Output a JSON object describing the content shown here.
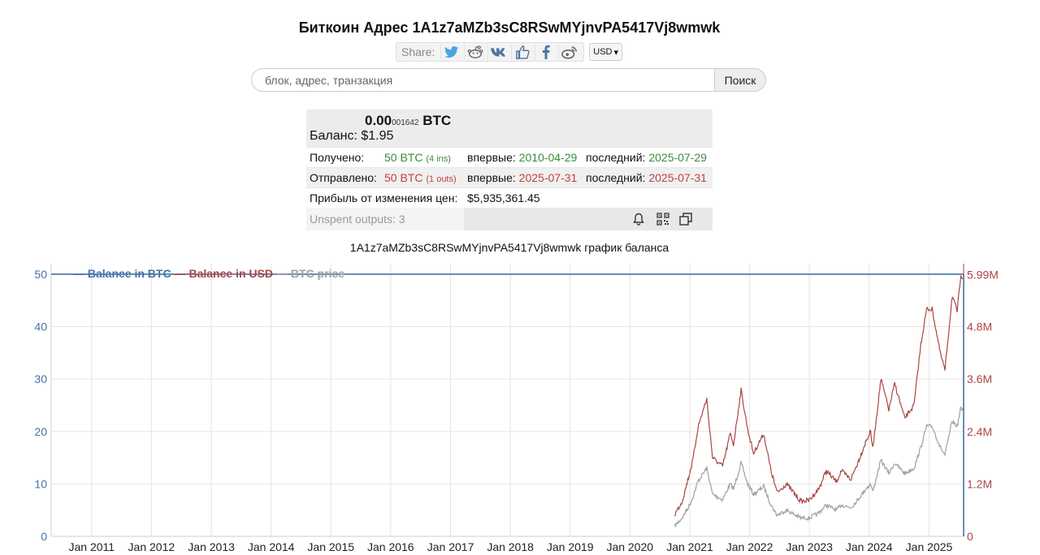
{
  "header": {
    "title": "Биткоин Адрес 1A1z7aMZb3sC8RSwMYjnvPA5417Vj8wmwk"
  },
  "share": {
    "label": "Share:",
    "icons": [
      "twitter-icon",
      "reddit-icon",
      "vk-icon",
      "like-icon",
      "facebook-icon",
      "weibo-icon"
    ],
    "currency": "USD"
  },
  "search": {
    "placeholder": "блок, адрес, транзакция",
    "button": "Поиск"
  },
  "summary": {
    "btc_main": "0.00",
    "btc_small": "001642",
    "btc_unit": "BTC",
    "balance_label": "Баланс:",
    "balance_usd": "$1.95",
    "received_label": "Получено:",
    "received_amount": "50 BTC",
    "received_count": "(4 ins)",
    "received_first_label": "впервые:",
    "received_first": "2010-04-29",
    "received_last_label": "последний:",
    "received_last": "2025-07-29",
    "sent_label": "Отправлено:",
    "sent_amount": "50 BTC",
    "sent_count": "(1 outs)",
    "sent_first_label": "впервые:",
    "sent_first": "2025-07-31",
    "sent_last_label": "последний:",
    "sent_last": "2025-07-31",
    "profit_label": "Прибыль от изменения цен:",
    "profit_value": "$5,935,361.45",
    "unspent": "Unspent outputs: 3"
  },
  "colors": {
    "btc": "#4572a7",
    "usd": "#aa4643",
    "price": "#a0a0a0",
    "green": "#3b8a3b",
    "red": "#c04040"
  },
  "chart_title": "1A1z7aMZb3sC8RSwMYjnvPA5417Vj8wmwk график баланса",
  "chart_data": {
    "type": "line",
    "title": "1A1z7aMZb3sC8RSwMYjnvPA5417Vj8wmwk график баланса",
    "legend": [
      "— Balance in BTC",
      "— Balance in USD",
      "— BTC price"
    ],
    "legend_position": "top-left",
    "grid": true,
    "x_ticks": [
      "Jan 2011",
      "Jan 2012",
      "Jan 2013",
      "Jan 2014",
      "Jan 2015",
      "Jan 2016",
      "Jan 2017",
      "Jan 2018",
      "Jan 2019",
      "Jan 2020",
      "Jan 2021",
      "Jan 2022",
      "Jan 2023",
      "Jan 2024",
      "Jan 2025"
    ],
    "xlim": [
      "2010-04-29",
      "2025-07-31"
    ],
    "y_left": {
      "ticks": [
        "0",
        "10",
        "20",
        "30",
        "40",
        "50"
      ],
      "ylim": [
        0,
        52
      ]
    },
    "y_right": {
      "ticks": [
        "0",
        "1.2M",
        "2.4M",
        "3.6M",
        "4.8M",
        "5.99M"
      ],
      "ylim": [
        0,
        6240000
      ]
    },
    "series": [
      {
        "name": "Balance in BTC",
        "axis": "left",
        "x": [
          "2010-04-29",
          "2025-07-31",
          "2025-07-31"
        ],
        "y": [
          50,
          50,
          0
        ]
      },
      {
        "name": "Balance in USD",
        "axis": "right",
        "x": [
          "2020-10-01",
          "2020-11-15",
          "2020-12-31",
          "2021-01-20",
          "2021-02-20",
          "2021-04-14",
          "2021-05-20",
          "2021-07-20",
          "2021-09-05",
          "2021-09-25",
          "2021-11-10",
          "2021-12-20",
          "2022-01-25",
          "2022-03-28",
          "2022-05-12",
          "2022-06-18",
          "2022-08-14",
          "2022-11-10",
          "2023-01-01",
          "2023-03-01",
          "2023-04-14",
          "2023-06-15",
          "2023-07-15",
          "2023-09-11",
          "2023-10-25",
          "2023-12-10",
          "2024-01-10",
          "2024-01-23",
          "2024-03-13",
          "2024-05-01",
          "2024-06-05",
          "2024-08-05",
          "2024-10-01",
          "2024-11-12",
          "2024-12-17",
          "2025-01-20",
          "2025-03-10",
          "2025-04-08",
          "2025-05-22",
          "2025-06-22",
          "2025-07-14",
          "2025-07-29",
          "2025-07-31"
        ],
        "y": [
          500000,
          800000,
          1450000,
          1750000,
          2500000,
          3150000,
          1800000,
          1600000,
          2350000,
          2100000,
          3350000,
          2450000,
          1900000,
          2350000,
          1500000,
          1000000,
          1200000,
          800000,
          830000,
          1100000,
          1500000,
          1250000,
          1500000,
          1300000,
          1700000,
          2150000,
          2400000,
          2000000,
          3600000,
          2900000,
          3500000,
          2700000,
          3000000,
          4400000,
          5200000,
          5200000,
          4200000,
          3800000,
          5500000,
          5150000,
          6000000,
          5900000,
          5930000
        ]
      },
      {
        "name": "BTC price",
        "axis": "left",
        "x": [
          "2020-10-01",
          "2020-11-15",
          "2020-12-31",
          "2021-01-20",
          "2021-02-20",
          "2021-04-14",
          "2021-05-20",
          "2021-07-20",
          "2021-09-05",
          "2021-09-25",
          "2021-11-10",
          "2021-12-20",
          "2022-01-25",
          "2022-03-28",
          "2022-05-12",
          "2022-06-18",
          "2022-08-14",
          "2022-11-10",
          "2023-01-01",
          "2023-03-01",
          "2023-04-14",
          "2023-06-15",
          "2023-07-15",
          "2023-09-11",
          "2023-10-25",
          "2023-12-10",
          "2024-01-10",
          "2024-01-23",
          "2024-03-13",
          "2024-05-01",
          "2024-06-05",
          "2024-08-05",
          "2024-10-01",
          "2024-11-12",
          "2024-12-17",
          "2025-01-20",
          "2025-03-10",
          "2025-04-08",
          "2025-05-22",
          "2025-06-22",
          "2025-07-14",
          "2025-07-29"
        ],
        "y": [
          2,
          3.5,
          6,
          7.5,
          10.5,
          13,
          8,
          7,
          10,
          9,
          14,
          10,
          8,
          9.5,
          6,
          4,
          5,
          3.5,
          3.5,
          4.5,
          6,
          5,
          6,
          5.5,
          7,
          9,
          10,
          8.5,
          14.5,
          12,
          14,
          12,
          13,
          17,
          21,
          21,
          17,
          15.5,
          22,
          21,
          24.5,
          24
        ]
      }
    ]
  }
}
